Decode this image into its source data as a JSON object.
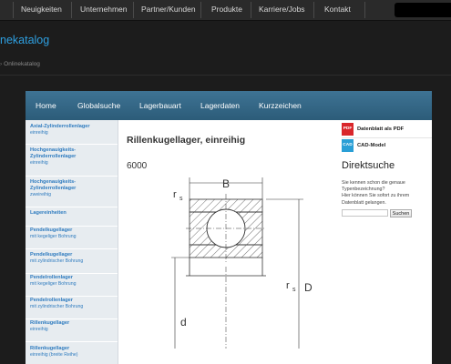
{
  "top_nav": {
    "items": [
      "Neuigkeiten",
      "Unternehmen",
      "Partner/Kunden",
      "Produkte",
      "Karriere/Jobs",
      "Kontakt"
    ]
  },
  "header": {
    "brand": "nekatalog",
    "breadcrumb": "Onlinekatalog"
  },
  "sub_nav": {
    "items": [
      "Home",
      "Globalsuche",
      "Lagerbauart",
      "Lagerdaten",
      "Kurzzeichen"
    ]
  },
  "sidebar": {
    "items": [
      {
        "title": "Axial-Zylinderrollenlager",
        "sub": "einreihig"
      },
      {
        "title": "Hochgenauigkeits-Zylinderrollenlager",
        "sub": "einreihig"
      },
      {
        "title": "Hochgenauigkeits-Zylinderrollenlager",
        "sub": "zweireihig"
      },
      {
        "title": "Lagereinheiten",
        "sub": ""
      },
      {
        "title": "Pendelkugellager",
        "sub": "mit kegeliger Bohrung"
      },
      {
        "title": "Pendelkugellager",
        "sub": "mit zylindrischer Bohrung"
      },
      {
        "title": "Pendelrollenlager",
        "sub": "mit kegeliger Bohrung"
      },
      {
        "title": "Pendelrollenlager",
        "sub": "mit zylindrischer Bohrung"
      },
      {
        "title": "Rillenkugellager",
        "sub": "einreihig"
      },
      {
        "title": "Rillenkugellager",
        "sub": "einreihig (breite Reihe)"
      }
    ]
  },
  "main": {
    "title": "Rillenkugellager, einreihig",
    "code": "6000",
    "drawing_labels": {
      "B": "B",
      "rs_top": "r",
      "rs_right": "r",
      "s": "s",
      "D": "D",
      "d": "d"
    }
  },
  "right": {
    "pdf_icon": "PDF",
    "pdf_label": "Datenblatt als PDF",
    "cad_icon": "CAD",
    "cad_label": "CAD-Model",
    "direkt_title": "Direktsuche",
    "direkt_text_1": "Sie kennen schon die genaue Typenbezeichnung?",
    "direkt_text_2": "Hier können Sie sofort zu ihrem Datenblatt gelangen.",
    "search_placeholder": "",
    "search_button": "Suchen"
  },
  "colors": {
    "brand": "#2e9fe0",
    "link": "#2e7bbf",
    "subnav": "#35678a",
    "pdf": "#d9262b",
    "cad": "#2a9fd6"
  }
}
